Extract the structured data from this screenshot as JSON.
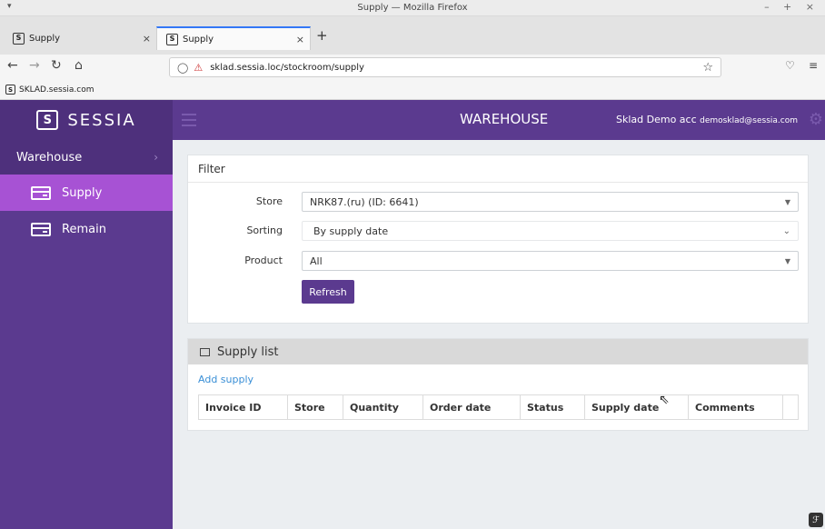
{
  "window": {
    "title": "Supply — Mozilla Firefox",
    "controls": "– + ×"
  },
  "tabs": [
    {
      "label": "Supply",
      "favicon": "S"
    },
    {
      "label": "Supply",
      "favicon": "S"
    }
  ],
  "url": "sklad.sessia.loc/stockroom/supply",
  "bookmark": {
    "label": "SKLAD.sessia.com",
    "favicon": "S"
  },
  "app": {
    "logo_text": "SESSIA",
    "logo_mark": "S",
    "section_title": "WAREHOUSE",
    "user_name": "Sklad Demo acc",
    "user_email": "demosklad@sessia.com",
    "accent_color": "#5b3a8f",
    "active_color": "#a752d4"
  },
  "sidebar": {
    "heading": "Warehouse",
    "items": [
      {
        "label": "Supply",
        "icon": "card-icon",
        "active": true
      },
      {
        "label": "Remain",
        "icon": "card-icon",
        "active": false
      }
    ]
  },
  "filter": {
    "title": "Filter",
    "store_label": "Store",
    "store_value": "NRK87.(ru) (ID: 6641)",
    "sorting_label": "Sorting",
    "sorting_value": "By supply date",
    "product_label": "Product",
    "product_value": "All",
    "refresh_label": "Refresh"
  },
  "supply_list": {
    "title": "Supply list",
    "add_label": "Add supply",
    "columns": [
      "Invoice ID",
      "Store",
      "Quantity",
      "Order date",
      "Status",
      "Supply date",
      "Comments"
    ]
  }
}
